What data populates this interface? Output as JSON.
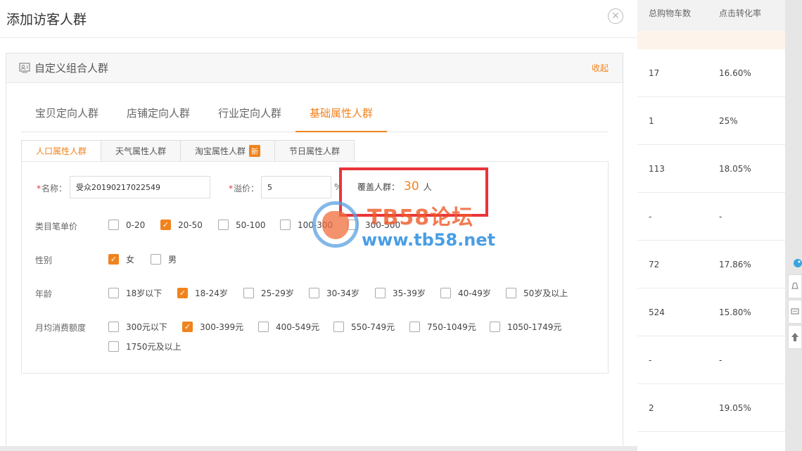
{
  "background_table": {
    "headers": [
      "总购物车数",
      "点击转化率"
    ],
    "rows": [
      [
        "17",
        "16.60%"
      ],
      [
        "1",
        "25%"
      ],
      [
        "113",
        "18.05%"
      ],
      [
        "-",
        "-"
      ],
      [
        "72",
        "17.86%"
      ],
      [
        "524",
        "15.80%"
      ],
      [
        "-",
        "-"
      ],
      [
        "2",
        "19.05%"
      ]
    ]
  },
  "modal": {
    "title": "添加访客人群",
    "close_icon": "close-circle-icon"
  },
  "panel": {
    "title": "自定义组合人群",
    "collapse_label": "收起"
  },
  "tabs": [
    "宝贝定向人群",
    "店铺定向人群",
    "行业定向人群",
    "基础属性人群"
  ],
  "active_tab": "基础属性人群",
  "subtabs": [
    {
      "label": "人口属性人群",
      "badge": ""
    },
    {
      "label": "天气属性人群",
      "badge": ""
    },
    {
      "label": "淘宝属性人群",
      "badge": "新"
    },
    {
      "label": "节日属性人群",
      "badge": ""
    }
  ],
  "form": {
    "name_label": "名称：",
    "name_value": "受众20190217022549",
    "premium_label": "溢价：",
    "premium_value": "5",
    "premium_unit": "%",
    "cover_label": "覆盖人群：",
    "cover_count": "30",
    "cover_unit": "人",
    "required_mark": "*"
  },
  "groups": {
    "price": {
      "label": "类目笔单价",
      "options": [
        {
          "label": "0-20",
          "checked": false
        },
        {
          "label": "20-50",
          "checked": true
        },
        {
          "label": "50-100",
          "checked": false
        },
        {
          "label": "100-300",
          "checked": false
        },
        {
          "label": "300-500",
          "checked": false
        }
      ]
    },
    "gender": {
      "label": "性别",
      "options": [
        {
          "label": "女",
          "checked": true
        },
        {
          "label": "男",
          "checked": false
        }
      ]
    },
    "age": {
      "label": "年龄",
      "options": [
        {
          "label": "18岁以下",
          "checked": false
        },
        {
          "label": "18-24岁",
          "checked": true
        },
        {
          "label": "25-29岁",
          "checked": false
        },
        {
          "label": "30-34岁",
          "checked": false
        },
        {
          "label": "35-39岁",
          "checked": false
        },
        {
          "label": "40-49岁",
          "checked": false
        },
        {
          "label": "50岁及以上",
          "checked": false
        }
      ]
    },
    "spend": {
      "label": "月均消费额度",
      "options": [
        {
          "label": "300元以下",
          "checked": false
        },
        {
          "label": "300-399元",
          "checked": true
        },
        {
          "label": "400-549元",
          "checked": false
        },
        {
          "label": "550-749元",
          "checked": false
        },
        {
          "label": "750-1049元",
          "checked": false
        },
        {
          "label": "1050-1749元",
          "checked": false
        },
        {
          "label": "1750元及以上",
          "checked": false
        }
      ]
    }
  },
  "watermark": {
    "title": "TB58论坛",
    "url": "www.tb58.net"
  },
  "colors": {
    "accent": "#f0831e",
    "highlight": "#e8353b"
  }
}
